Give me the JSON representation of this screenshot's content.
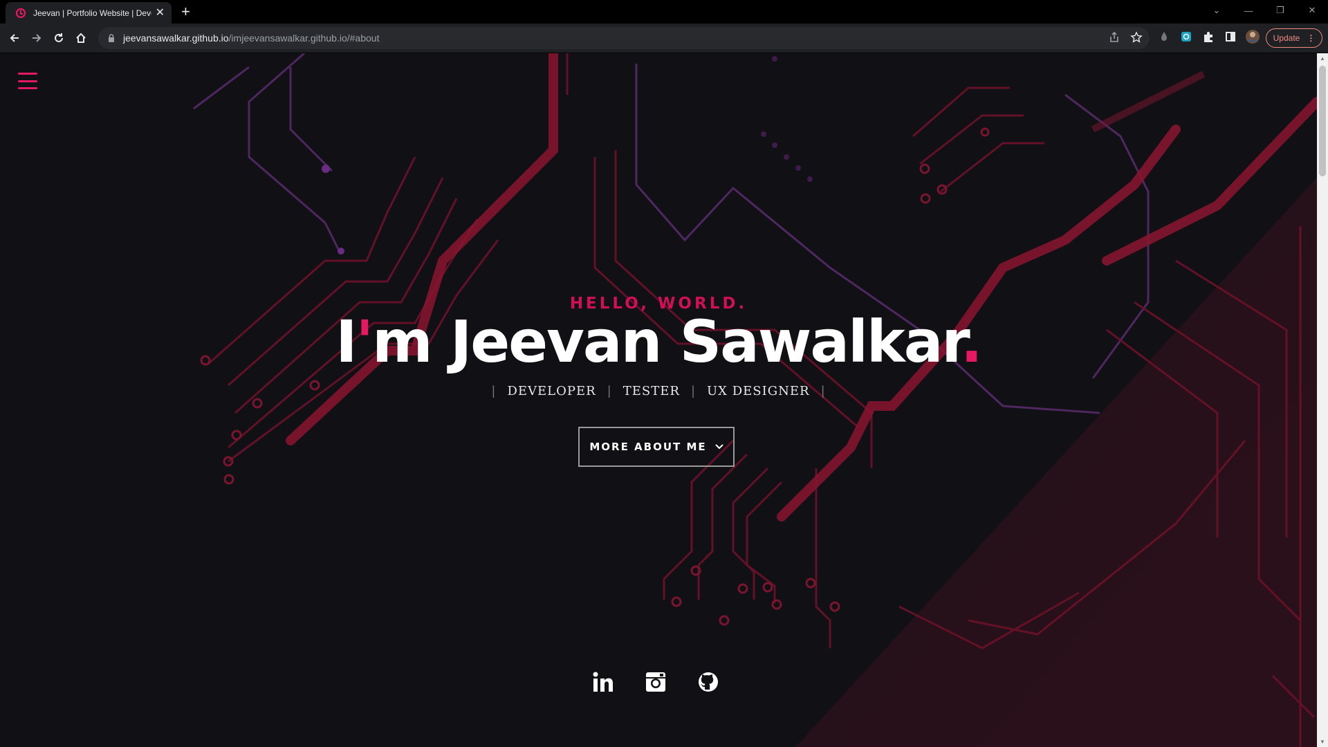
{
  "browser": {
    "tab_title": "Jeevan | Portfolio Website | Deve",
    "url_host": "jeevansawalkar.github.io",
    "url_path": "/imjeevansawalkar.github.io/#about",
    "update_label": "Update"
  },
  "hero": {
    "greeting": "HELLO, WORLD.",
    "name_i": "I",
    "name_apostrophe": "'",
    "name_rest": "m Jeevan Sawalkar",
    "name_dot": ".",
    "roles": [
      "DEVELOPER",
      "TESTER",
      "UX DESIGNER"
    ],
    "separator": "|",
    "cta_label": "MORE ABOUT ME"
  },
  "socials": {
    "icons": [
      "linkedin-icon",
      "instagram-icon",
      "github-icon"
    ]
  },
  "colors": {
    "accent": "#e5195f",
    "background": "#111015"
  }
}
